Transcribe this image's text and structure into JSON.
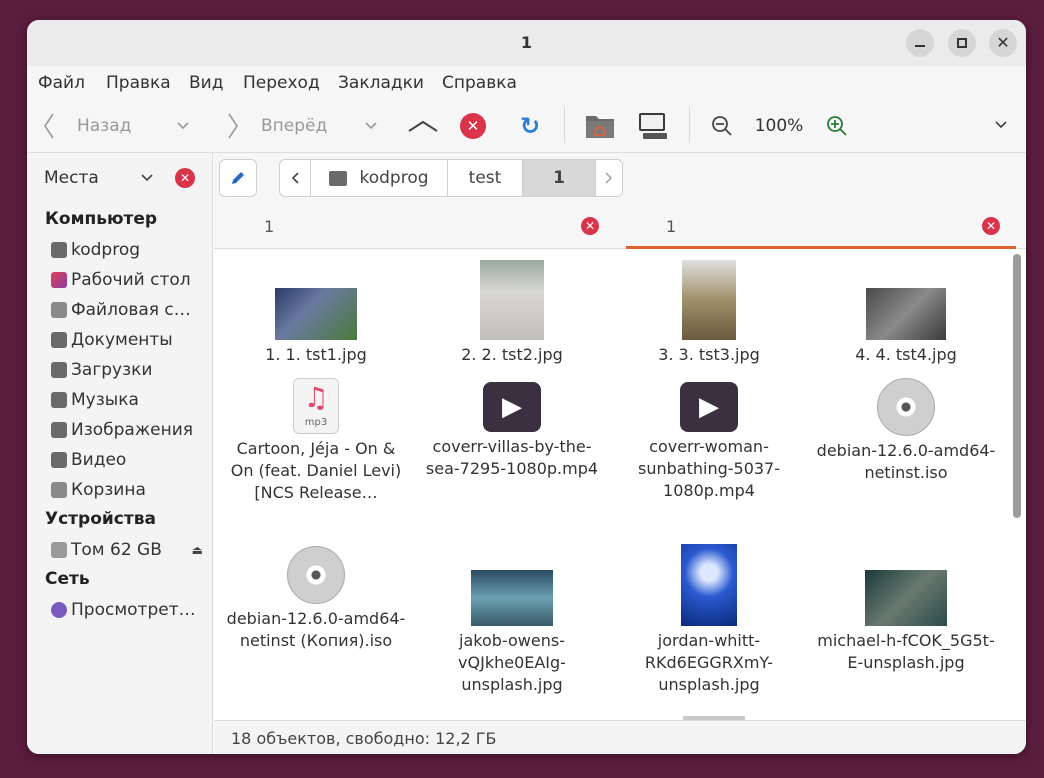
{
  "window": {
    "title": "1"
  },
  "menu": [
    "Файл",
    "Правка",
    "Вид",
    "Переход",
    "Закладки",
    "Справка"
  ],
  "toolbar": {
    "back_label": "Назад",
    "forward_label": "Вперёд",
    "zoom": "100%"
  },
  "sidebar": {
    "places_label": "Места",
    "computer_header": "Компьютер",
    "computer_items": [
      "kodprog",
      "Рабочий стол",
      "Файловая с…",
      "Документы",
      "Загрузки",
      "Музыка",
      "Изображения",
      "Видео",
      "Корзина"
    ],
    "devices_header": "Устройства",
    "device_item": "Том 62 GB",
    "network_header": "Сеть",
    "network_item": "Просмотрет…"
  },
  "path": [
    "kodprog",
    "test",
    "1"
  ],
  "tabs": [
    "1",
    "1"
  ],
  "files": [
    {
      "name": "1. 1. tst1.jpg",
      "type": "image",
      "color": "#4a5a8a"
    },
    {
      "name": "2. 2. tst2.jpg",
      "type": "image",
      "color": "#c8c8c0"
    },
    {
      "name": "3. 3. tst3.jpg",
      "type": "image",
      "color": "#8a7a60"
    },
    {
      "name": "4. 4. tst4.jpg",
      "type": "image",
      "color": "#5a5a5a"
    },
    {
      "name": "Cartoon, Jéja - On & On (feat. Daniel Levi) [NCS Release…",
      "type": "audio",
      "badge": "mp3"
    },
    {
      "name": "coverr-villas-by-the-sea-7295-1080p.mp4",
      "type": "video"
    },
    {
      "name": "coverr-woman-sunbathing-5037-1080p.mp4",
      "type": "video"
    },
    {
      "name": "debian-12.6.0-amd64-netinst.iso",
      "type": "disc"
    },
    {
      "name": "debian-12.6.0-amd64-netinst (Копия).iso",
      "type": "disc"
    },
    {
      "name": "jakob-owens-vQJkhe0EAIg-unsplash.jpg",
      "type": "image",
      "color": "#3a6a80"
    },
    {
      "name": "jordan-whitt-RKd6EGGRXmY-unsplash.jpg",
      "type": "image",
      "color": "#1a3a8a"
    },
    {
      "name": "michael-h-fCOK_5G5t-E-unsplash.jpg",
      "type": "image",
      "color": "#2a5050"
    }
  ],
  "status": "18 объектов, свободно: 12,2 ГБ"
}
